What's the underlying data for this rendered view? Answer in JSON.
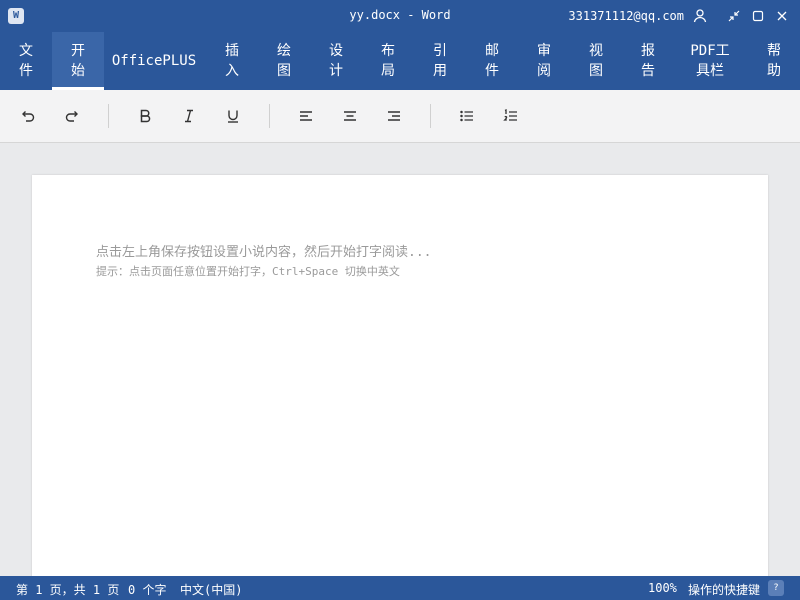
{
  "titlebar": {
    "app_letter": "W",
    "title": "yy.docx - Word",
    "account": "331371112@qq.com"
  },
  "ribbon": {
    "tabs": [
      {
        "label": "文\n件"
      },
      {
        "label": "开\n始",
        "active": true
      },
      {
        "label": "OfficePLUS"
      },
      {
        "label": "插\n入"
      },
      {
        "label": "绘\n图"
      },
      {
        "label": "设\n计"
      },
      {
        "label": "布\n局"
      },
      {
        "label": "引\n用"
      },
      {
        "label": "邮\n件"
      },
      {
        "label": "审\n阅"
      },
      {
        "label": "视\n图"
      },
      {
        "label": "报\n告"
      },
      {
        "label": "PDF工\n具栏"
      },
      {
        "label": "帮\n助"
      }
    ]
  },
  "toolbar": {
    "icons": [
      "undo-icon",
      "redo-icon",
      "bold-icon",
      "italic-icon",
      "underline-icon",
      "align-left-icon",
      "align-center-icon",
      "align-right-icon",
      "bullet-list-icon",
      "numbered-list-icon"
    ]
  },
  "document": {
    "hint_main": "点击左上角保存按钮设置小说内容，然后开始打字阅读...",
    "hint_sub": "提示：点击页面任意位置开始打字，Ctrl+Space 切换中英文"
  },
  "status": {
    "page_info": "第 1 页，共 1 页",
    "word_count": "0 个字",
    "language": "中文(中国)",
    "zoom": "100%",
    "shortcuts": "操作的快捷键",
    "help_label": "?"
  },
  "colors": {
    "brand": "#2b579a",
    "toolbar_bg": "#f3f3f4",
    "canvas_bg": "#e9eaec"
  }
}
